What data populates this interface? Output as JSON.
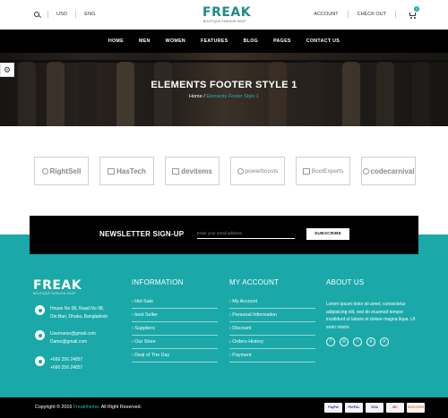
{
  "topbar": {
    "currency": "USD",
    "language": "ENG",
    "logo": "FREAK",
    "logo_tagline": "BOUTIQUE FASHION SHOP",
    "account": "ACCOUNT",
    "checkout": "CHECK OUT",
    "cart_count": "0"
  },
  "nav": {
    "items": [
      "HOME",
      "MEN",
      "WOMEN",
      "FEATURES",
      "BLOG",
      "PAGES",
      "CONTACT US"
    ]
  },
  "hero": {
    "title": "ELEMENTS FOOTER STYLE 1",
    "crumb_home": "Home",
    "crumb_sep": " / ",
    "crumb_current": "Elements Footer Style 1"
  },
  "brands": [
    "RightSell",
    "HasTech",
    "devitems",
    "powerboosts",
    "BootExperts",
    "codecarnival"
  ],
  "newsletter": {
    "label": "NEWSLETTER SIGN-UP",
    "placeholder": "Enter your email address",
    "button": "SUBSCRIBE"
  },
  "footer": {
    "logo": "FREAK",
    "logo_tagline": "BOUTIQUE FASHION SHOP",
    "address": [
      "House No 08, Road No 08,",
      "Din Bari, Dhaka, Bangladesh"
    ],
    "emails": [
      "Username@gmail.com",
      "Damo@gmail.com"
    ],
    "phones": [
      "+660 256 24857",
      "+660 256 24857"
    ],
    "information": {
      "heading": "INFORMATION",
      "items": [
        "Hot Sale",
        "best Seller",
        "Suppliers",
        "Our Store",
        "Deal of The Day"
      ]
    },
    "my_account": {
      "heading": "MY ACCOUNT",
      "items": [
        "My Account",
        "Personal Information",
        "Discount",
        "Orders History",
        "Payment"
      ]
    },
    "about": {
      "heading": "ABOUT US",
      "text": "Lorem ipsum dolor sit amet, consectetur adipisicing elit, sed do eiusmod tempor incididunt ut labore et dolore magna liqua. Ut enim minim."
    }
  },
  "bottom": {
    "copy_prefix": "Copyright © 2016 ",
    "copy_brand": "Freaktheme",
    "copy_suffix": ". All Right Reserved.",
    "payments": [
      "PayPal",
      "PAYPAL",
      "VISA",
      "MC",
      "DISCOVER"
    ]
  }
}
